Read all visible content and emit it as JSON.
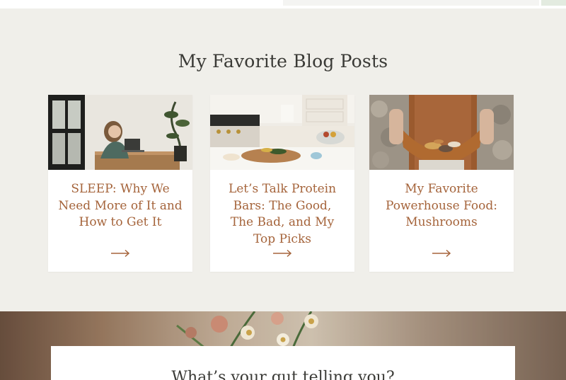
{
  "section": {
    "title": "My Favorite Blog Posts"
  },
  "posts": [
    {
      "title": "SLEEP: Why We Need More of It and How to Get It",
      "image": "woman-at-desk-photo",
      "link_icon": "arrow-right-icon"
    },
    {
      "title": "Let’s Talk Protein Bars: The Good, The Bad, and My Top Picks",
      "image": "kitchen-counter-photo",
      "link_icon": "arrow-right-icon"
    },
    {
      "title": "My Favorite Powerhouse Food: Mushrooms",
      "image": "mushrooms-in-apron-photo",
      "link_icon": "arrow-right-icon"
    }
  ],
  "signup": {
    "heading": "What’s your gut telling you?"
  },
  "colors": {
    "background": "#f0efea",
    "card": "#ffffff",
    "accent": "#a5643b",
    "heading": "#3a3a36"
  }
}
